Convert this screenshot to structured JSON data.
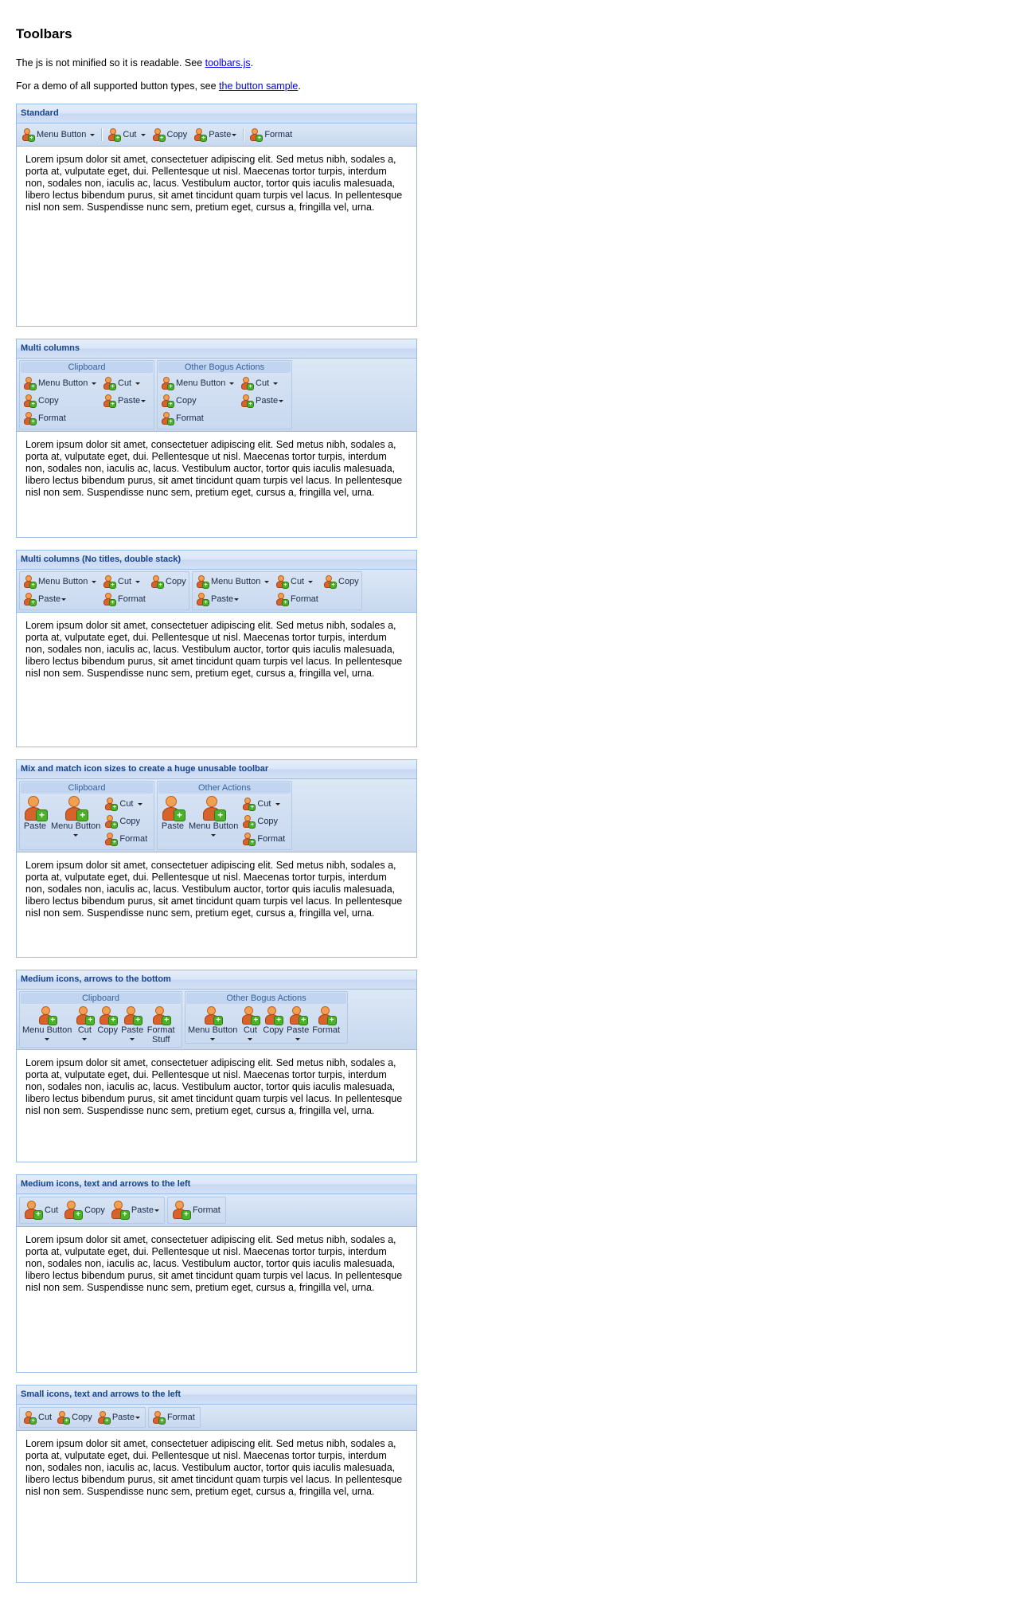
{
  "page": {
    "title": "Toolbars",
    "intro1_prefix": "The js is not minified so it is readable. See ",
    "intro1_link": "toolbars.js",
    "intro1_suffix": ".",
    "intro2_prefix": "For a demo of all supported button types, see ",
    "intro2_link": "the button sample",
    "intro2_suffix": "."
  },
  "labels": {
    "menu_button": "Menu Button",
    "cut": "Cut",
    "copy": "Copy",
    "paste": "Paste",
    "format": "Format",
    "format_stuff": "Format Stuff"
  },
  "lorem": "Lorem ipsum dolor sit amet, consectetuer adipiscing elit. Sed metus nibh, sodales a, porta at, vulputate eget, dui. Pellentesque ut nisl. Maecenas tortor turpis, interdum non, sodales non, iaculis ac, lacus. Vestibulum auctor, tortor quis iaculis malesuada, libero lectus bibendum purus, sit amet tincidunt quam turpis vel lacus. In pellentesque nisl non sem. Suspendisse nunc sem, pretium eget, cursus a, fringilla vel, urna.",
  "panels": [
    {
      "title": "Standard"
    },
    {
      "title": "Multi columns",
      "groups": [
        "Clipboard",
        "Other Bogus Actions"
      ]
    },
    {
      "title": "Multi columns (No titles, double stack)"
    },
    {
      "title": "Mix and match icon sizes to create a huge unusable toolbar",
      "groups": [
        "Clipboard",
        "Other Actions"
      ]
    },
    {
      "title": "Medium icons, arrows to the bottom",
      "groups": [
        "Clipboard",
        "Other Bogus Actions"
      ]
    },
    {
      "title": "Medium icons, text and arrows to the left"
    },
    {
      "title": "Small icons, text and arrows to the left"
    }
  ],
  "icons": {
    "user_add": "user-add-icon",
    "dropdown": "dropdown-arrow-icon"
  },
  "colors": {
    "panel_border": "#99bbe8",
    "header_text": "#15428b",
    "toolbar_bg": "#d0def0",
    "link": "#0000ee"
  }
}
